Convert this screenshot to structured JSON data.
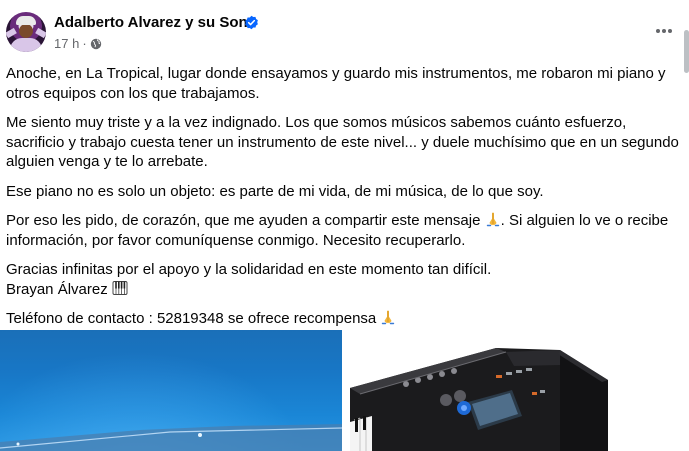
{
  "post": {
    "author": "Adalberto Alvarez y su Son",
    "verified": true,
    "time": "17 h",
    "audience_icon": "globe-icon",
    "menu_icon": "more-options-icon"
  },
  "text": {
    "p1": "Anoche, en La Tropical, lugar donde ensayamos y guardo mis instrumentos, me robaron mi piano y otros equipos con los que trabajamos.",
    "p2": "Me siento muy triste y a la vez indignado. Los que somos músicos sabemos cuánto esfuerzo, sacrificio y trabajo cuesta tener un instrumento de este nivel... y duele muchísimo que en un segundo alguien venga y te lo arrebate.",
    "p3": "Ese piano no es solo un objeto: es parte de mi vida, de mi música, de lo que soy.",
    "p4_a": "Por eso les pido, de corazón, que me ayuden a compartir este mensaje",
    "p4_b": ". Si alguien lo ve o recibe información, por favor comuníquense conmigo. Necesito recuperarlo.",
    "p5_line1": "Gracias infinitas por el apoyo y la solidaridad en este momento tan difícil.",
    "p5_line2": "Brayan Álvarez",
    "p6": "Teléfono de contacto : 52819348 se ofrece recompensa"
  },
  "colors": {
    "verified_badge": "#0866ff",
    "secondary_text": "#65676b",
    "primary_text": "#050505"
  }
}
